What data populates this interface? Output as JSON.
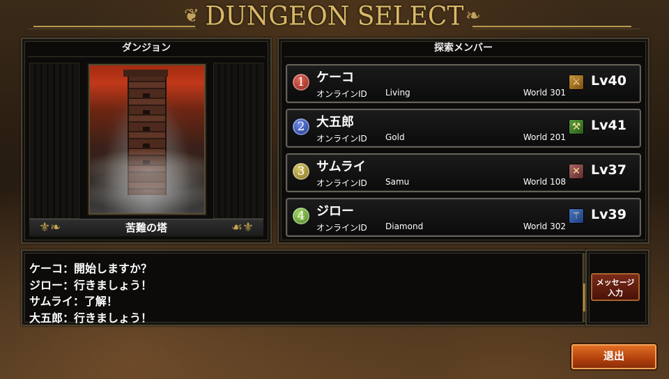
{
  "title": "DUNGEON SELECT",
  "dungeon": {
    "header": "ダンジョン",
    "name": "苦難の塔"
  },
  "members": {
    "header": "探索メンバー",
    "online_id_label": "オンラインID",
    "list": [
      {
        "num": "1",
        "name": "ケーコ",
        "online_id": "Living",
        "world": "World 301",
        "level": "Lv40",
        "icon": "sword-icon"
      },
      {
        "num": "2",
        "name": "大五郎",
        "online_id": "Gold",
        "world": "World 201",
        "level": "Lv41",
        "icon": "axe-icon"
      },
      {
        "num": "3",
        "name": "サムライ",
        "online_id": "Samu",
        "world": "World 108",
        "level": "Lv37",
        "icon": "crossed-swords-icon"
      },
      {
        "num": "4",
        "name": "ジロー",
        "online_id": "Diamond",
        "world": "World 302",
        "level": "Lv39",
        "icon": "staff-icon"
      }
    ]
  },
  "chat": {
    "lines": [
      "ケーコ：開始しますか？",
      "ジロー：行きましょう！",
      "サムライ：了解！",
      "大五郎：行きましょう！"
    ],
    "message_button": [
      "メッセージ",
      "入力"
    ]
  },
  "exit_button": "退出",
  "colors": {
    "title_gold": "#d8b868",
    "exit_orange": "#d8601c",
    "frame": "#4a4232"
  }
}
